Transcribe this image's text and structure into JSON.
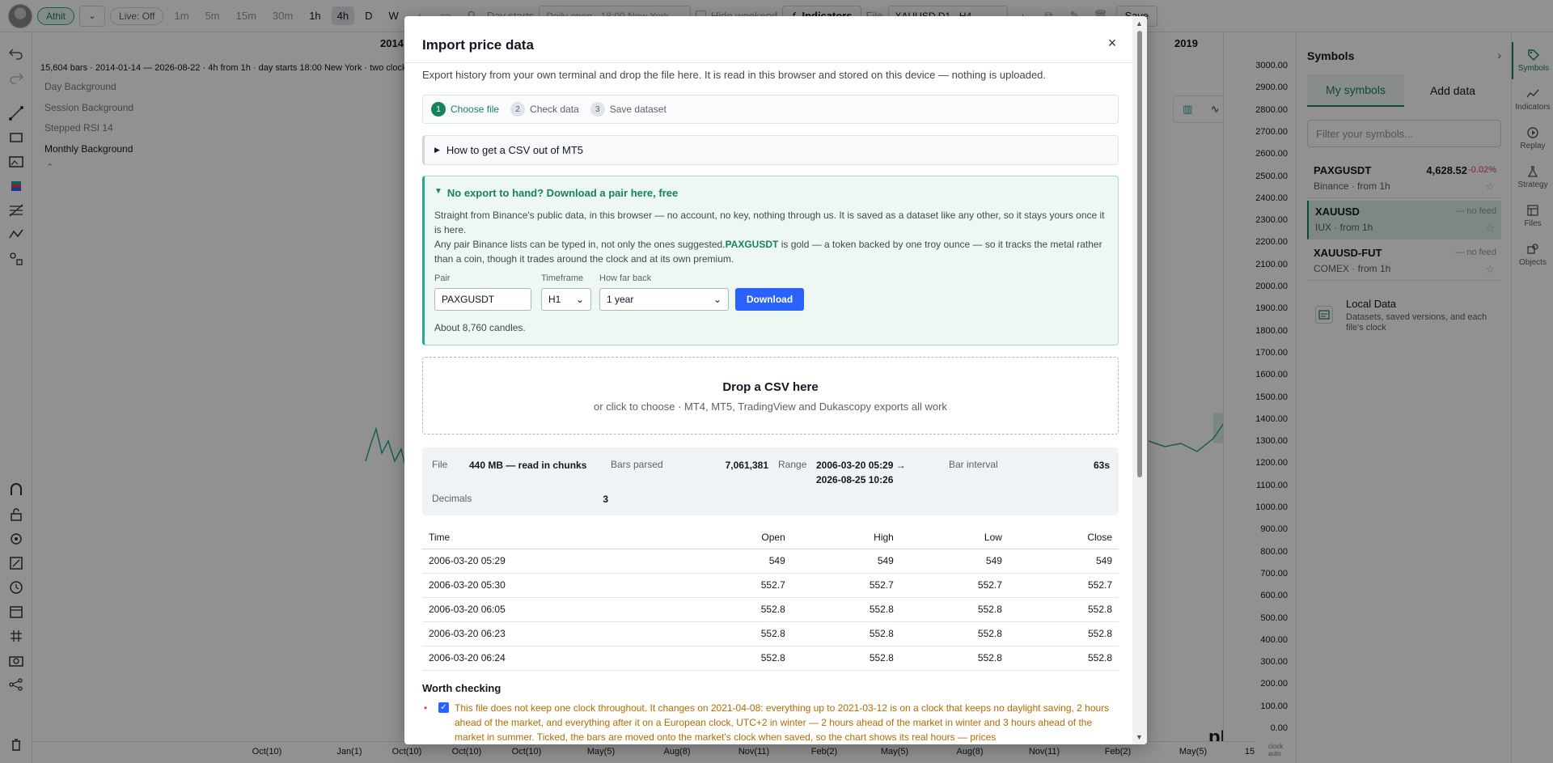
{
  "toolbar": {
    "user": "Athit",
    "live": "Live: Off",
    "timeframes": [
      "1m",
      "5m",
      "15m",
      "30m",
      "1h",
      "4h",
      "D",
      "W"
    ],
    "active_timeframe": "4h",
    "day_starts_label": "Day starts",
    "day_starts_value": "Daily open · 18:00 New York",
    "hide_weekend": "Hide weekend",
    "indicators": "Indicators",
    "file_label": "File",
    "file_value": "XAUUSD D1 · H4",
    "save": "Save"
  },
  "chart": {
    "info": "15,604 bars · 2014-01-14 — 2026-08-22 · 4h from 1h · day starts 18:00 New York · two clocks",
    "legend": [
      "Day Background",
      "Session Background",
      "Stepped RSI 14",
      "Monthly Background"
    ],
    "year_left": "2014",
    "year_right": "2019",
    "y_ticks": [
      "3000.00",
      "2900.00",
      "2800.00",
      "2700.00",
      "2600.00",
      "2500.00",
      "2400.00",
      "2300.00",
      "2200.00",
      "2100.00",
      "2000.00",
      "1900.00",
      "1800.00",
      "1700.00",
      "1600.00",
      "1500.00",
      "1400.00",
      "1300.00",
      "1200.00",
      "1100.00",
      "1000.00",
      "900.00",
      "800.00",
      "700.00",
      "600.00",
      "500.00",
      "400.00",
      "300.00",
      "200.00",
      "100.00",
      "0.00"
    ],
    "x_ticks": [
      "Oct(10)",
      "Jan(1)",
      "Oct(10)",
      "Oct(10)",
      "Oct(10)",
      "May(5)",
      "Aug(8)",
      "Nov(11)",
      "Feb(2)",
      "May(5)",
      "Aug(8)",
      "Nov(11)",
      "Feb(2)",
      "May(5)",
      "15"
    ],
    "corner": "clock auto",
    "watermark": "pPRO.com"
  },
  "symbols": {
    "title": "Symbols",
    "tabs": [
      "My symbols",
      "Add data"
    ],
    "filter_placeholder": "Filter your symbols...",
    "items": [
      {
        "name": "PAXGUSDT",
        "sub": "Binance · from 1h",
        "price": "4,628.52",
        "change": "-0.02%"
      },
      {
        "name": "XAUUSD",
        "sub": "IUX · from 1h",
        "status": "— no feed"
      },
      {
        "name": "XAUUSD-FUT",
        "sub": "COMEX · from 1h",
        "status": "— no feed"
      }
    ],
    "local_title": "Local Data",
    "local_sub": "Datasets, saved versions, and each file's clock"
  },
  "rail": [
    "Symbols",
    "Indicators",
    "Replay",
    "Strategy",
    "Files",
    "Objects"
  ],
  "modal": {
    "title": "Import price data",
    "intro": "Export history from your own terminal and drop the file here. It is read in this browser and stored on this device — nothing is uploaded.",
    "steps": [
      "Choose file",
      "Check data",
      "Save dataset"
    ],
    "howto": "How to get a CSV out of MT5",
    "download": {
      "title": "No export to hand? Download a pair here, free",
      "p1": "Straight from Binance's public data, in this browser — no account, no key, nothing through us. It is saved as a dataset like any other, so it stays yours once it is here.",
      "p2a": "Any pair Binance lists can be typed in, not only the ones suggested.",
      "p2hl": "PAXGUSDT",
      "p2b": " is gold — a token backed by one troy ounce — so it tracks the metal rather than a coin, though it trades around the clock and at its own premium.",
      "pair_label": "Pair",
      "pair_value": "PAXGUSDT",
      "tf_label": "Timeframe",
      "tf_value": "H1",
      "range_label": "How far back",
      "range_value": "1 year",
      "button": "Download",
      "note": "About 8,760 candles."
    },
    "drop_title": "Drop a CSV here",
    "drop_sub": "or click to choose · MT4, MT5, TradingView and Dukascopy exports all work",
    "stats": {
      "file_label": "File",
      "file_value": "440 MB — read in chunks",
      "bars_label": "Bars parsed",
      "bars_value": "7,061,381",
      "range_label": "Range",
      "range_value_1": "2006-03-20 05:29 →",
      "range_value_2": "2026-08-25 10:26",
      "interval_label": "Bar interval",
      "interval_value": "63s",
      "decimals_label": "Decimals",
      "decimals_value": "3"
    },
    "table": {
      "headers": [
        "Time",
        "Open",
        "High",
        "Low",
        "Close"
      ],
      "rows": [
        [
          "2006-03-20 05:29",
          "549",
          "549",
          "549",
          "549"
        ],
        [
          "2006-03-20 05:30",
          "552.7",
          "552.7",
          "552.7",
          "552.7"
        ],
        [
          "2006-03-20 06:05",
          "552.8",
          "552.8",
          "552.8",
          "552.8"
        ],
        [
          "2006-03-20 06:23",
          "552.8",
          "552.8",
          "552.8",
          "552.8"
        ],
        [
          "2006-03-20 06:24",
          "552.8",
          "552.8",
          "552.8",
          "552.8"
        ]
      ]
    },
    "worth_title": "Worth checking",
    "warning": "This file does not keep one clock throughout. It changes on 2021-04-08: everything up to 2021-03-12 is on a clock that keeps no daylight saving, 2 hours ahead of the market, and everything after it on a European clock, UTC+2 in winter — 2 hours ahead of the market in winter and 3 hours ahead of the market in summer. Ticked, the bars are moved onto the market's clock when saved, so the chart shows its real hours — prices"
  }
}
